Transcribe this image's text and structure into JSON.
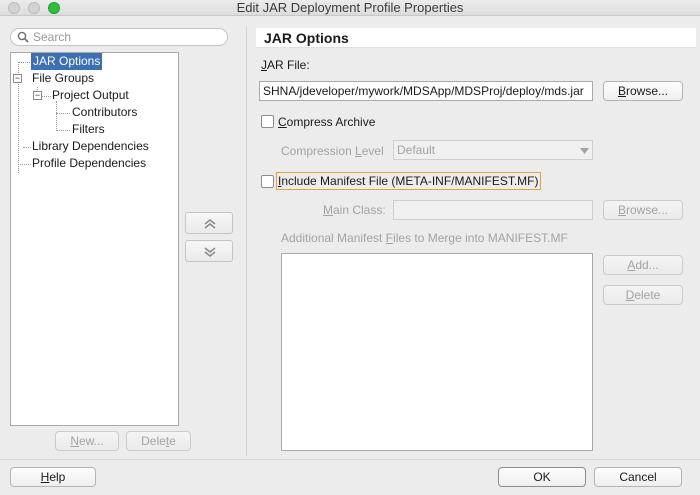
{
  "window": {
    "title": "Edit JAR Deployment Profile Properties"
  },
  "search": {
    "placeholder": "Search",
    "value": ""
  },
  "tree": {
    "items": [
      {
        "label": "JAR Options"
      },
      {
        "label": "File Groups",
        "toggle": "⊟"
      },
      {
        "label": "Project Output",
        "toggle": "⊟"
      },
      {
        "label": "Contributors"
      },
      {
        "label": "Filters"
      },
      {
        "label": "Library Dependencies"
      },
      {
        "label": "Profile Dependencies"
      }
    ],
    "new_label_pre": "",
    "new_label_mn": "N",
    "new_label_post": "ew...",
    "delete_label_pre": "Dele",
    "delete_label_mn": "t",
    "delete_label_post": "e"
  },
  "main": {
    "section_title": "JAR Options",
    "jar_file_label_mn": "J",
    "jar_file_label_post": "AR File:",
    "jar_file_value": "SHNA/jdeveloper/mywork/MDSApp/MDSProj/deploy/mds.jar",
    "browse_pre": "",
    "browse_mn": "B",
    "browse_post": "rowse...",
    "compress_pre": "",
    "compress_mn": "C",
    "compress_post": "ompress Archive",
    "compression_level_pre": "Compression ",
    "compression_level_mn": "L",
    "compression_level_post": "evel",
    "compression_level_value": "Default",
    "include_manifest_pre": "",
    "include_manifest_mn": "I",
    "include_manifest_post": "nclude Manifest File (META-INF/MANIFEST.MF)",
    "main_class_pre": "",
    "main_class_mn": "M",
    "main_class_post": "ain Class:",
    "main_class_value": "",
    "browse2_pre": "",
    "browse2_mn": "B",
    "browse2_post": "rowse...",
    "additional_manifest_pre": "Additional Manifest ",
    "additional_manifest_mn": "F",
    "additional_manifest_post": "iles to Merge into MANIFEST.MF",
    "add_pre": "",
    "add_mn": "A",
    "add_post": "dd...",
    "delete_pre": "",
    "delete_mn": "D",
    "delete_post": "elete"
  },
  "footer": {
    "help_pre": "",
    "help_mn": "H",
    "help_post": "elp",
    "ok_label": "OK",
    "cancel_label": "Cancel"
  },
  "colors": {
    "selection": "#3d6fb3",
    "focus_ring": "#e3a23c",
    "zoom_button": "#2ac13e"
  },
  "icons": [
    "search-icon",
    "chevron-up-icon",
    "chevron-down-icon",
    "dropdown-arrow-icon",
    "tree-collapse-icon"
  ]
}
